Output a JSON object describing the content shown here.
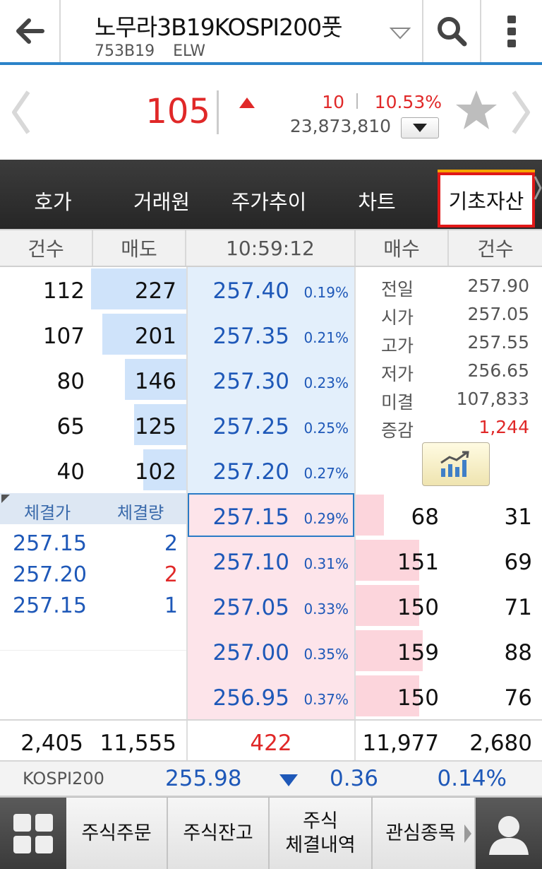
{
  "header": {
    "title": "노무라3B19KOSPI200풋",
    "code": "753B19",
    "type": "ELW"
  },
  "summary": {
    "price": "105",
    "change": "10",
    "change_pct": "10.53%",
    "volume": "23,873,810"
  },
  "tabs": [
    {
      "label": "호가"
    },
    {
      "label": "거래원"
    },
    {
      "label": "주가추이"
    },
    {
      "label": "차트"
    },
    {
      "label": "기초자산"
    }
  ],
  "orderbook": {
    "headers": {
      "count_left": "건수",
      "ask": "매도",
      "time": "10:59:12",
      "bid": "매수",
      "count_right": "건수"
    },
    "asks": [
      {
        "count": "112",
        "volume": "227",
        "price": "257.40",
        "pct": "0.19%",
        "bar": 0.51
      },
      {
        "count": "107",
        "volume": "201",
        "price": "257.35",
        "pct": "0.21%",
        "bar": 0.45
      },
      {
        "count": "80",
        "volume": "146",
        "price": "257.30",
        "pct": "0.23%",
        "bar": 0.33
      },
      {
        "count": "65",
        "volume": "125",
        "price": "257.25",
        "pct": "0.25%",
        "bar": 0.28
      },
      {
        "count": "40",
        "volume": "102",
        "price": "257.20",
        "pct": "0.27%",
        "bar": 0.23
      }
    ],
    "bids": [
      {
        "price": "257.15",
        "pct": "0.29%",
        "volume": "68",
        "count": "31",
        "bar": 0.15
      },
      {
        "price": "257.10",
        "pct": "0.31%",
        "volume": "151",
        "count": "69",
        "bar": 0.34
      },
      {
        "price": "257.05",
        "pct": "0.33%",
        "volume": "150",
        "count": "71",
        "bar": 0.34
      },
      {
        "price": "257.00",
        "pct": "0.35%",
        "volume": "159",
        "count": "88",
        "bar": 0.36
      },
      {
        "price": "256.95",
        "pct": "0.37%",
        "volume": "150",
        "count": "76",
        "bar": 0.34
      }
    ],
    "info": [
      {
        "label": "전일",
        "value": "257.90"
      },
      {
        "label": "시가",
        "value": "257.05"
      },
      {
        "label": "고가",
        "value": "257.55"
      },
      {
        "label": "저가",
        "value": "256.65"
      },
      {
        "label": "미결",
        "value": "107,833"
      },
      {
        "label": "증감",
        "value": "1,244"
      }
    ],
    "trades_header": {
      "price": "체결가",
      "volume": "체결량"
    },
    "trades": [
      {
        "price": "257.15",
        "volume": "2"
      },
      {
        "price": "257.20",
        "volume": "2"
      },
      {
        "price": "257.15",
        "volume": "1"
      }
    ],
    "totals": {
      "ask_count": "2,405",
      "ask_volume": "11,555",
      "diff": "422",
      "bid_volume": "11,977",
      "bid_count": "2,680"
    }
  },
  "kospi": {
    "label": "KOSPI200",
    "value": "255.98",
    "change": "0.36",
    "change_pct": "0.14%"
  },
  "bottom_nav": [
    {
      "label": "주식주문"
    },
    {
      "label": "주식잔고"
    },
    {
      "label": "주식\n체결내역"
    },
    {
      "label": "관심종목"
    }
  ],
  "colors": {
    "accent": "#2b83c9",
    "up": "#e02828",
    "down": "#1e58b8",
    "active_tab_border": "#e01818"
  }
}
